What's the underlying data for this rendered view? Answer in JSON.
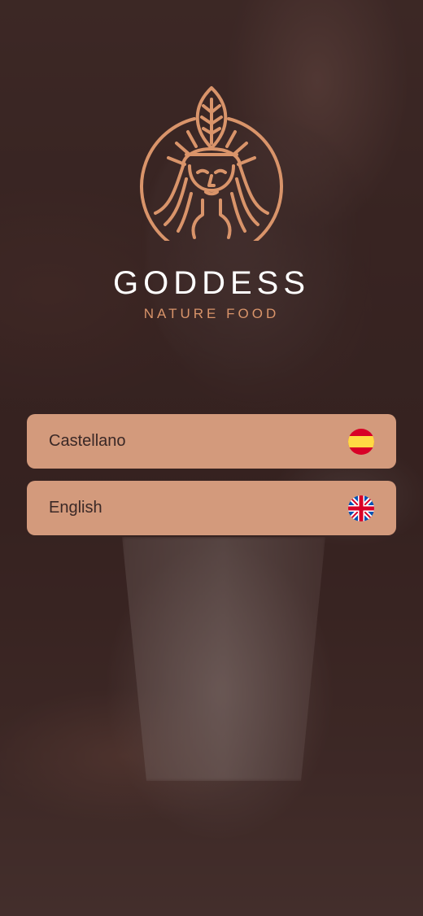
{
  "brand": {
    "name": "GODDESS",
    "tagline": "NATURE FOOD",
    "accent_color": "#d9946a",
    "button_color": "#d39a7c"
  },
  "languages": [
    {
      "label": "Castellano",
      "flag_icon": "spain-flag-icon"
    },
    {
      "label": "English",
      "flag_icon": "uk-flag-icon"
    }
  ]
}
